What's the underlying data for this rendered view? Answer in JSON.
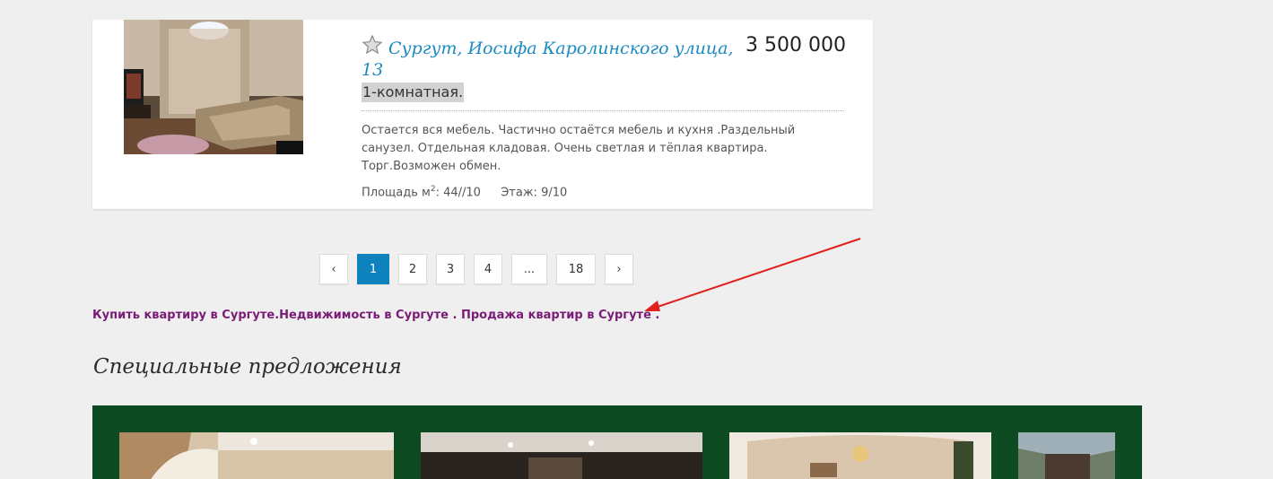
{
  "listing": {
    "title": "Сургут, Иосифа Каролинского улица, 13",
    "price": "3 500 000",
    "rooms": "1-комнатная.",
    "description": "Остается вся мебель. Частично остаётся мебель и кухня .Раздельный санузел. Отдельная кладовая. Очень светлая и тёплая квартира. Торг.Возможен обмен.",
    "area_label": "Площадь м",
    "area_sup": "2",
    "area_value": ": 44//10",
    "floor_label": "Этаж:",
    "floor_value": "9/10",
    "photo_icon": "apartment-photo",
    "favorite_icon": "star-icon"
  },
  "pagination": {
    "prev": "‹",
    "pages": [
      "1",
      "2",
      "3",
      "4",
      "...",
      "18"
    ],
    "current": "1",
    "next": "›"
  },
  "seo_link": "Купить квартиру в Сургуте.Недвижимость в Сургуте . Продажа квартир в Сургуте .",
  "special": {
    "heading": "Специальные предложения"
  },
  "colors": {
    "accent": "#0e82bd",
    "title_link": "#1a8ac1",
    "seo_link": "#7a1b78",
    "special_panel": "#0e4a22",
    "arrow": "#e01f1f"
  }
}
